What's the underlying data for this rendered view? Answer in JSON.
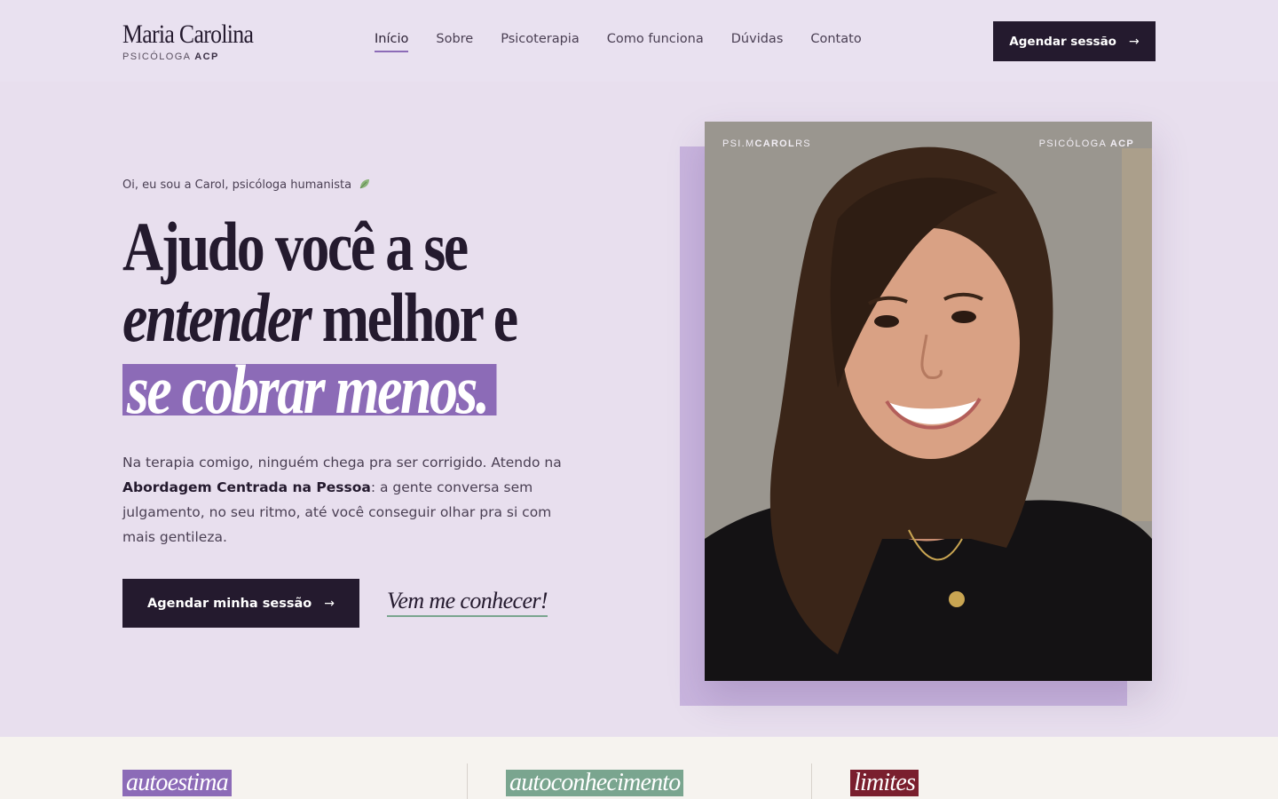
{
  "brand": {
    "name": "Maria Carolina",
    "subtitle_prefix": "PSICÓLOGA",
    "subtitle_bold": "ACP"
  },
  "nav": {
    "items": [
      {
        "label": "Início",
        "active": true
      },
      {
        "label": "Sobre"
      },
      {
        "label": "Psicoterapia"
      },
      {
        "label": "Como funciona"
      },
      {
        "label": "Dúvidas"
      },
      {
        "label": "Contato"
      }
    ],
    "cta_label": "Agendar sessão"
  },
  "hero": {
    "eyebrow": "Oi, eu sou a Carol, psicóloga humanista",
    "eyebrow_icon": "leaf-icon",
    "headline_line1": "Ajudo você a se",
    "headline_line2_italic": "entender",
    "headline_line2_rest": " melhor e",
    "headline_line3_highlight": "se cobrar menos.",
    "lead_before": "Na terapia comigo, ninguém chega pra ser corrigido. Atendo na ",
    "lead_bold": "Abordagem Centrada na Pessoa",
    "lead_after": ": a gente conversa sem julgamento, no seu ritmo, até você conseguir olhar pra si com mais gentileza.",
    "primary_cta": "Agendar minha sessão",
    "secondary_cta": "Vem me conhecer!"
  },
  "photo": {
    "tag_left_prefix": "PSI.M",
    "tag_left_bold": "CAROL",
    "tag_left_suffix": "RS",
    "tag_right_prefix": "PSICÓLOGA",
    "tag_right_bold": "ACP"
  },
  "topics": [
    {
      "label": "autoestima",
      "color": "#8c6bb7"
    },
    {
      "label": "autoconhecimento",
      "color": "#7aa58f"
    },
    {
      "label": "limites",
      "color": "#7a1f2e"
    }
  ],
  "colors": {
    "accent": "#8c6bb7",
    "dark": "#241a2e",
    "green": "#7aa58f"
  }
}
